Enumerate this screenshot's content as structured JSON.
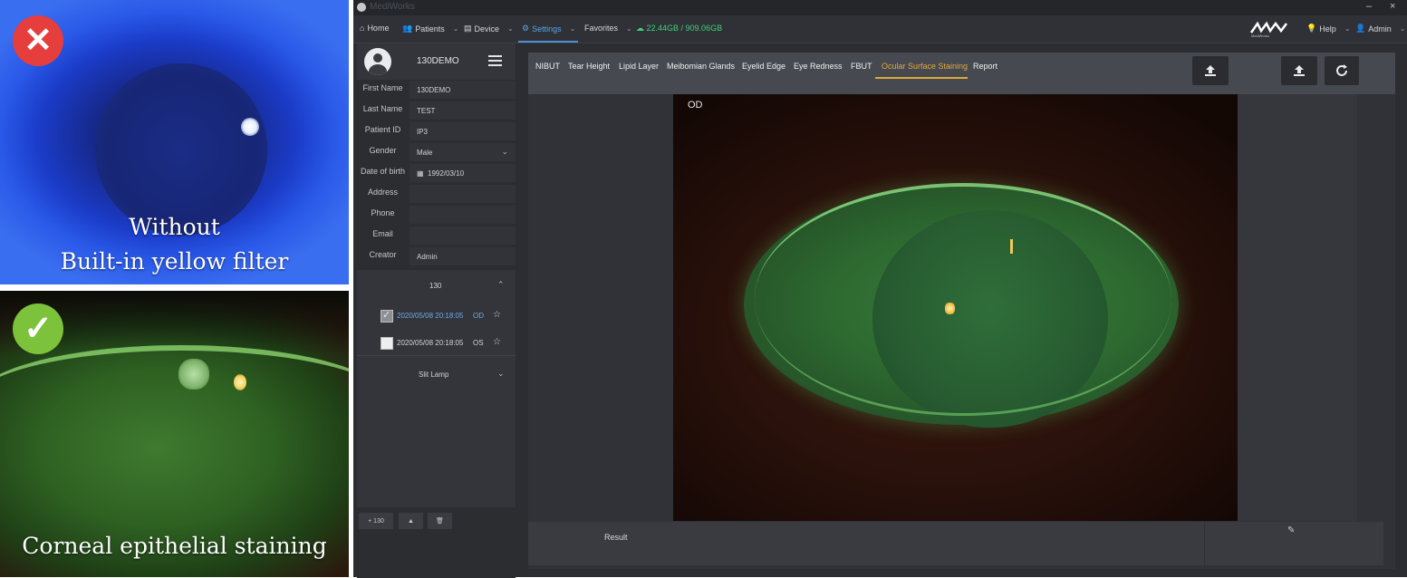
{
  "comparison": {
    "top": {
      "caption_line1": "Without",
      "caption_line2": "Built-in yellow filter",
      "badge": "x-icon",
      "badge_color": "#e63d3d"
    },
    "bottom": {
      "caption": "Corneal epithelial staining",
      "badge": "check-icon",
      "badge_color": "#7cc23a"
    }
  },
  "window": {
    "title": "MediWorks"
  },
  "menu": {
    "home": "Home",
    "patients": "Patients",
    "device": "Device",
    "settings": "Settings",
    "favorites": "Favorites",
    "storage": "22.44GB / 909.06GB",
    "help": "Help",
    "admin": "Admin"
  },
  "patient": {
    "display_name": "130DEMO",
    "first_name_label": "First Name",
    "first_name": "130DEMO",
    "last_name_label": "Last Name",
    "last_name": "TEST",
    "patient_id_label": "Patient ID",
    "patient_id": "IP3",
    "gender_label": "Gender",
    "gender": "Male",
    "dob_label": "Date of birth",
    "dob": "1992/03/10",
    "address_label": "Address",
    "address": "",
    "phone_label": "Phone",
    "phone": "",
    "email_label": "Email",
    "email": "",
    "creator_label": "Creator",
    "creator": "Admin"
  },
  "sessions": {
    "group": "130",
    "records": [
      {
        "datetime": "2020/05/08 20:18:05",
        "eye": "OD",
        "checked": true
      },
      {
        "datetime": "2020/05/08 20:18:05",
        "eye": "OS",
        "checked": false
      }
    ],
    "footer_group": "Slit Lamp",
    "buttons": {
      "add": "+ 130",
      "up": "▲",
      "delete": "🗑"
    }
  },
  "tabs": [
    "NIBUT",
    "Tear Height",
    "Lipid Layer",
    "Meibomian Glands",
    "Eyelid Edge",
    "Eye Redness",
    "FBUT",
    "Ocular Surface Staining",
    "Report"
  ],
  "active_tab": "Ocular Surface Staining",
  "viewer": {
    "eye_label": "OD"
  },
  "result": {
    "label": "Result"
  },
  "colors": {
    "accent_tab": "#e0a93a",
    "storage": "#3fd27c",
    "selection": "#6fa8e6"
  }
}
